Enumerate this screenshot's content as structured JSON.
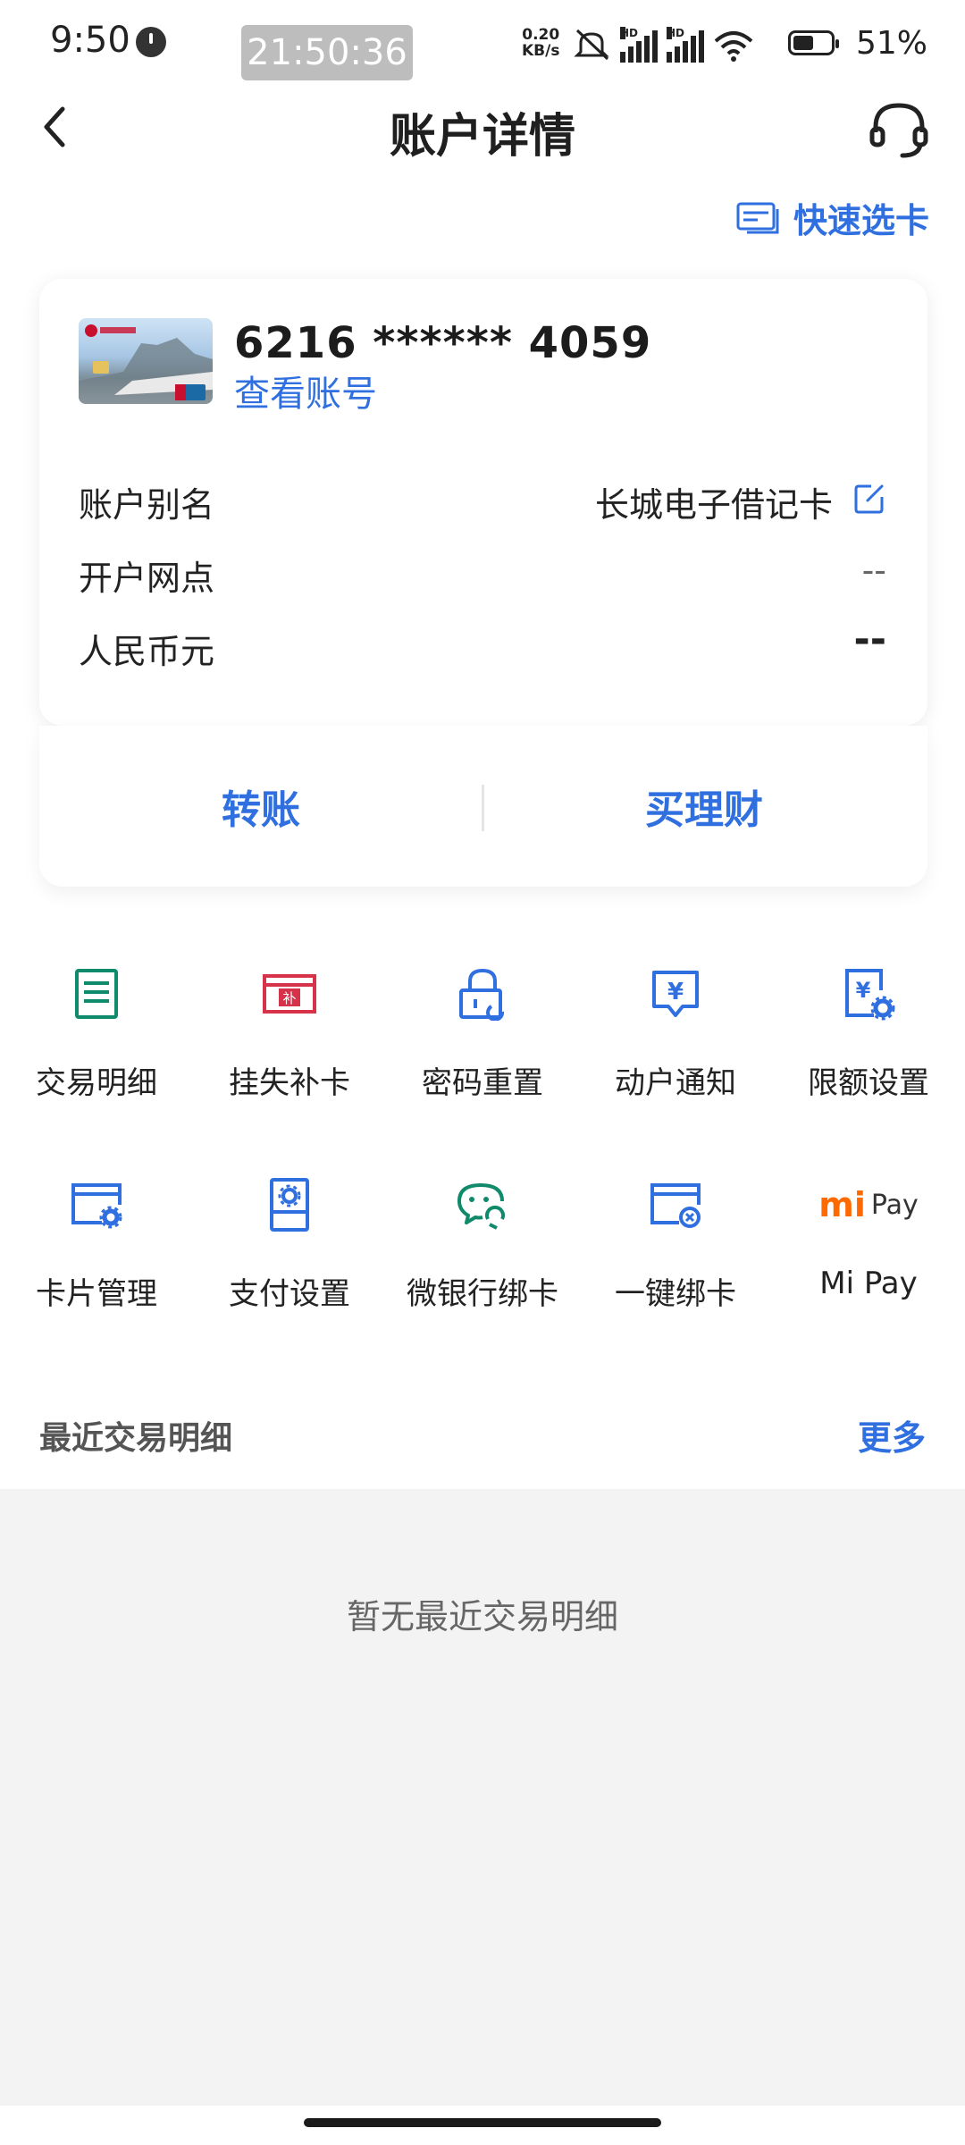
{
  "status_bar": {
    "time": "9:50",
    "overlay_time": "21:50:36",
    "net_speed_value": "0.20",
    "net_speed_unit": "KB/s",
    "battery": "51%",
    "hd_label": "HD"
  },
  "header": {
    "title": "账户详情",
    "quick_card": "快速选卡"
  },
  "account": {
    "card_number": "6216 ****** 4059",
    "view_account": "查看账号",
    "rows": [
      {
        "label": "账户别名",
        "value": "长城电子借记卡"
      },
      {
        "label": "开户网点",
        "value": "--"
      },
      {
        "label": "人民币元",
        "value": "--"
      }
    ]
  },
  "actions": {
    "transfer": "转账",
    "buy_wealth": "买理财"
  },
  "services": [
    {
      "label": "交易明细",
      "icon": "document-list-icon"
    },
    {
      "label": "挂失补卡",
      "icon": "card-replace-icon"
    },
    {
      "label": "密码重置",
      "icon": "lock-reset-icon"
    },
    {
      "label": "动户通知",
      "icon": "yuan-notice-icon"
    },
    {
      "label": "限额设置",
      "icon": "limit-settings-icon"
    },
    {
      "label": "卡片管理",
      "icon": "card-settings-icon"
    },
    {
      "label": "支付设置",
      "icon": "payment-settings-icon"
    },
    {
      "label": "微银行绑卡",
      "icon": "wechat-bind-icon"
    },
    {
      "label": "一键绑卡",
      "icon": "card-bind-icon"
    },
    {
      "label": "Mi Pay",
      "icon": "mi-pay-icon"
    }
  ],
  "mipay_logo": {
    "mi": "mi",
    "pay": "Pay"
  },
  "recent": {
    "title": "最近交易明细",
    "more": "更多",
    "empty": "暂无最近交易明细"
  },
  "colors": {
    "accent_blue": "#2f6fe0",
    "green": "#0f8a6a",
    "red": "#d6334a",
    "orange": "#ff6a00"
  }
}
